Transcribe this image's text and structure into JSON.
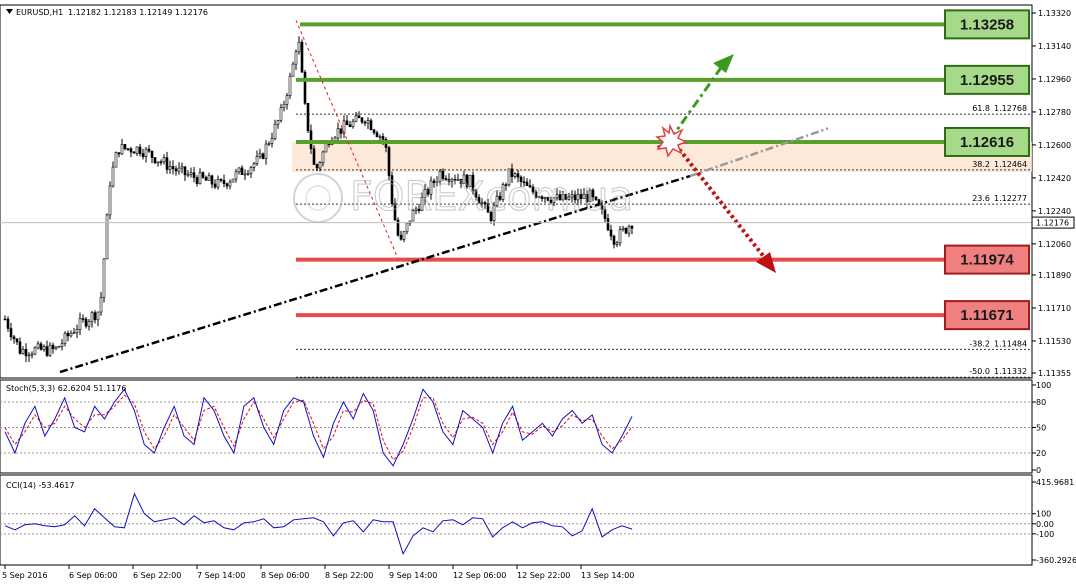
{
  "header": {
    "title": "EURUSD,H1",
    "ohlc": "1.12182 1.12183 1.12149 1.12176"
  },
  "colors": {
    "resistance": "#5aa02c",
    "resistance_box": "#a6da8a",
    "support": "#e54b4b",
    "support_box": "#f08080",
    "trendline": "#000000",
    "fib_zone": "#fde3cf",
    "stoch_main": "#1010c0",
    "stoch_signal": "#e01010",
    "cci": "#1010c0",
    "arrow_up": "#3c9a1e",
    "arrow_down": "#c01010"
  },
  "chart_data": [
    {
      "type": "candlestick",
      "title": "EURUSD,H1",
      "ylim": [
        1.11355,
        1.1332
      ],
      "y_ticks": [
        "1.13320",
        "1.13140",
        "1.12960",
        "1.12780",
        "1.12600",
        "1.12420",
        "1.12240",
        "1.12060",
        "1.11890",
        "1.11710",
        "1.11530",
        "1.11355"
      ],
      "current_price": "1.12176",
      "x_ticks": [
        "5 Sep 2016",
        "6 Sep 06:00",
        "6 Sep 22:00",
        "7 Sep 14:00",
        "8 Sep 06:00",
        "8 Sep 22:00",
        "9 Sep 14:00",
        "12 Sep 06:00",
        "12 Sep 22:00",
        "13 Sep 14:00"
      ],
      "levels": [
        {
          "label": "1.13258",
          "value": 1.13258,
          "kind": "resistance"
        },
        {
          "label": "1.12955",
          "value": 1.12955,
          "kind": "resistance"
        },
        {
          "label": "1.12616",
          "value": 1.12616,
          "kind": "resistance"
        },
        {
          "label": "1.11974",
          "value": 1.11974,
          "kind": "support"
        },
        {
          "label": "1.11671",
          "value": 1.11671,
          "kind": "support"
        }
      ],
      "fibonacci": [
        {
          "label": "61.8",
          "price": "1.12768",
          "value": 1.12768
        },
        {
          "label": "38.2",
          "price": "1.12464",
          "value": 1.12464
        },
        {
          "label": "23.6",
          "price": "1.12277",
          "value": 1.12277
        },
        {
          "label": "-38.2",
          "price": "1.11484",
          "value": 1.11484
        },
        {
          "label": "-50.0",
          "price": "1.11332",
          "value": 1.11332
        }
      ],
      "watermark": "FOREXcom.ua"
    },
    {
      "type": "line",
      "title": "Stoch(5,3,3) 62.6204 51.1176",
      "ylim": [
        0,
        100
      ],
      "y_ticks": [
        "100",
        "80",
        "50",
        "20",
        "0"
      ],
      "series": [
        {
          "name": "main",
          "values": [
            45,
            20,
            55,
            75,
            40,
            60,
            85,
            50,
            45,
            75,
            60,
            80,
            95,
            70,
            30,
            20,
            50,
            75,
            40,
            30,
            85,
            70,
            40,
            20,
            75,
            85,
            50,
            30,
            70,
            85,
            80,
            40,
            15,
            55,
            80,
            60,
            90,
            70,
            20,
            5,
            30,
            60,
            95,
            80,
            45,
            30,
            70,
            60,
            50,
            20,
            55,
            75,
            35,
            45,
            55,
            40,
            60,
            70,
            55,
            65,
            30,
            20,
            40,
            63
          ]
        },
        {
          "name": "signal",
          "values": [
            50,
            30,
            45,
            65,
            50,
            55,
            75,
            60,
            50,
            65,
            65,
            75,
            88,
            78,
            45,
            25,
            40,
            65,
            50,
            35,
            70,
            75,
            50,
            28,
            60,
            80,
            60,
            38,
            60,
            80,
            82,
            55,
            25,
            40,
            70,
            68,
            82,
            78,
            35,
            12,
            22,
            50,
            85,
            85,
            55,
            38,
            60,
            62,
            55,
            30,
            45,
            68,
            45,
            42,
            52,
            45,
            52,
            65,
            58,
            60,
            40,
            25,
            35,
            51
          ]
        }
      ]
    },
    {
      "type": "line",
      "title": "CCI(14) -53.4617",
      "ylim": [
        -360.2926,
        415.9681
      ],
      "y_ticks": [
        "415.9681",
        "100",
        "0.00",
        "-100",
        "-360.2926"
      ],
      "series": [
        {
          "name": "CCI",
          "values": [
            -20,
            -60,
            -10,
            0,
            -20,
            -30,
            -10,
            80,
            -20,
            150,
            60,
            -30,
            -40,
            300,
            100,
            20,
            40,
            60,
            -10,
            80,
            10,
            30,
            -40,
            -60,
            10,
            20,
            50,
            -40,
            -30,
            40,
            50,
            60,
            20,
            -120,
            10,
            30,
            -80,
            40,
            20,
            20,
            -300,
            -120,
            -40,
            -80,
            30,
            40,
            -10,
            60,
            50,
            -130,
            -40,
            20,
            -40,
            10,
            20,
            -20,
            -30,
            -120,
            -70,
            150,
            -130,
            -60,
            -20,
            -53
          ]
        }
      ]
    }
  ]
}
